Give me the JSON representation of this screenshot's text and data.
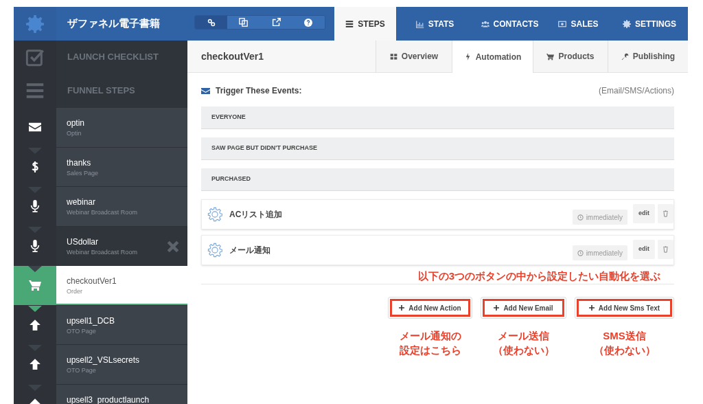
{
  "top_bar": {
    "funnel_name": "ザファネル電子書籍",
    "tool_buttons": [
      {
        "kind": "link",
        "selected": true
      },
      {
        "kind": "copy",
        "selected": false
      },
      {
        "kind": "external",
        "selected": false
      },
      {
        "kind": "help",
        "selected": false
      }
    ],
    "tabs": [
      {
        "label": "STEPS",
        "kind": "bars",
        "selected": true
      },
      {
        "label": "STATS",
        "kind": "chart",
        "selected": false
      },
      {
        "label": "CONTACTS",
        "kind": "users",
        "selected": false
      },
      {
        "label": "SALES",
        "kind": "money",
        "selected": false
      },
      {
        "label": "SETTINGS",
        "kind": "gear",
        "selected": false
      }
    ]
  },
  "sidebar": {
    "sections": [
      {
        "label": "LAUNCH CHECKLIST",
        "kind": "check"
      },
      {
        "label": "FUNNEL STEPS",
        "kind": "bars"
      }
    ],
    "steps": [
      {
        "name": "optin",
        "type_label": "Optin",
        "kind": "envelope",
        "selected": false,
        "hovered": false
      },
      {
        "name": "thanks",
        "type_label": "Sales Page",
        "kind": "dollar",
        "selected": false,
        "hovered": false
      },
      {
        "name": "webinar",
        "type_label": "Webinar Broadcast Room",
        "kind": "mic",
        "selected": false,
        "hovered": false
      },
      {
        "name": "USdollar",
        "type_label": "Webinar Broadcast Room",
        "kind": "mic",
        "selected": false,
        "hovered": true
      },
      {
        "name": "checkoutVer1",
        "type_label": "Order",
        "kind": "cart",
        "selected": true,
        "hovered": false
      },
      {
        "name": "upsell1_DCB",
        "type_label": "OTO Page",
        "kind": "arrow",
        "selected": false,
        "hovered": false
      },
      {
        "name": "upsell2_VSLsecrets",
        "type_label": "OTO Page",
        "kind": "arrow",
        "selected": false,
        "hovered": false
      },
      {
        "name": "upsell3_productlaunch",
        "kind": "arrow",
        "selected": false,
        "hovered": false
      }
    ]
  },
  "main": {
    "title": "checkoutVer1",
    "subtabs": [
      {
        "label": "Overview",
        "kind": "grid",
        "selected": false
      },
      {
        "label": "Automation",
        "kind": "bolt",
        "selected": true
      },
      {
        "label": "Products",
        "kind": "cart",
        "selected": false
      },
      {
        "label": "Publishing",
        "kind": "wrench",
        "selected": false
      }
    ],
    "trigger_heading": "Trigger These Events:",
    "trigger_hint": "(Email/SMS/Actions)",
    "groups": [
      "EVERYONE",
      "SAW PAGE BUT DIDN'T PURCHASE",
      "PURCHASED"
    ],
    "actions": [
      {
        "name": "ACリスト追加",
        "timing": "immediately",
        "edit": "edit"
      },
      {
        "name": "メール通知",
        "timing": "immediately",
        "edit": "edit"
      }
    ],
    "add_buttons": [
      {
        "label": "Add New Action",
        "caption": [
          "メール通知の",
          "設定はこちら"
        ]
      },
      {
        "label": "Add New Email",
        "caption": [
          "メール送信",
          "（使わない）"
        ]
      },
      {
        "label": "Add New Sms Text",
        "caption": [
          "SMS送信",
          "（使わない）"
        ]
      }
    ],
    "annotation": "以下の3つのボタンの中から設定したい自動化を選ぶ"
  }
}
